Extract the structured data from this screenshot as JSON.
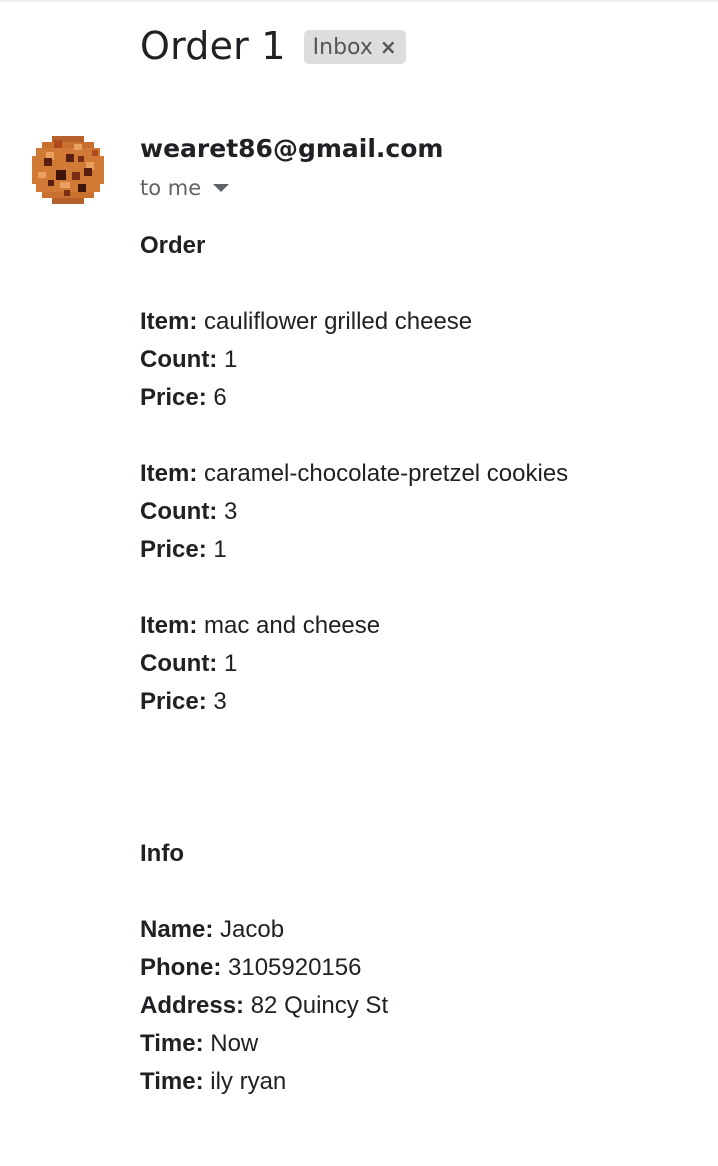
{
  "email": {
    "subject": "Order 1",
    "label": "Inbox",
    "label_close_glyph": "×",
    "sender": "wearet86@gmail.com",
    "recipient": "to me",
    "avatar_icon": "cookie-avatar-icon"
  },
  "order": {
    "heading": "Order",
    "items": [
      {
        "item_label": "Item:",
        "item": "cauliflower grilled cheese",
        "count_label": "Count:",
        "count": "1",
        "price_label": "Price:",
        "price": "6"
      },
      {
        "item_label": "Item:",
        "item": "caramel-chocolate-pretzel cookies",
        "count_label": "Count:",
        "count": "3",
        "price_label": "Price:",
        "price": "1"
      },
      {
        "item_label": "Item:",
        "item": "mac and cheese",
        "count_label": "Count:",
        "count": "1",
        "price_label": "Price:",
        "price": "3"
      }
    ]
  },
  "info": {
    "heading": "Info",
    "fields": [
      {
        "label": "Name:",
        "value": "Jacob"
      },
      {
        "label": "Phone:",
        "value": "3105920156"
      },
      {
        "label": "Address:",
        "value": "82 Quincy St"
      },
      {
        "label": "Time:",
        "value": "Now"
      },
      {
        "label": "Time:",
        "value": "ily ryan"
      }
    ]
  },
  "colors": {
    "chip_bg": "#dddddd",
    "text_primary": "#202124",
    "text_secondary": "#5f6368"
  }
}
